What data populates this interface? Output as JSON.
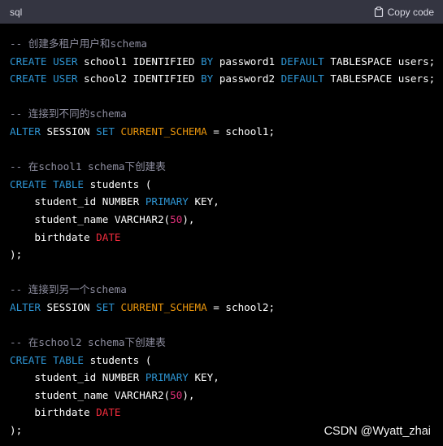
{
  "header": {
    "language": "sql",
    "copy_label": "Copy code"
  },
  "colors": {
    "header_bg": "#343541",
    "code_bg": "#000000",
    "comment": "#8e8ea0",
    "keyword": "#2e95d3",
    "type": "#f22c3d",
    "builtin": "#e9950c",
    "number": "#df3079",
    "text": "#ffffff"
  },
  "code": {
    "lines": [
      [
        {
          "t": "-- 创建多租户用户和schema",
          "c": "comment"
        }
      ],
      [
        {
          "t": "CREATE",
          "c": "kw"
        },
        {
          "t": " ",
          "c": "text"
        },
        {
          "t": "USER",
          "c": "kw"
        },
        {
          "t": " school1 IDENTIFIED ",
          "c": "text"
        },
        {
          "t": "BY",
          "c": "kw"
        },
        {
          "t": " password1 ",
          "c": "text"
        },
        {
          "t": "DEFAULT",
          "c": "kw"
        },
        {
          "t": " TABLESPACE users;",
          "c": "text"
        }
      ],
      [
        {
          "t": "CREATE",
          "c": "kw"
        },
        {
          "t": " ",
          "c": "text"
        },
        {
          "t": "USER",
          "c": "kw"
        },
        {
          "t": " school2 IDENTIFIED ",
          "c": "text"
        },
        {
          "t": "BY",
          "c": "kw"
        },
        {
          "t": " password2 ",
          "c": "text"
        },
        {
          "t": "DEFAULT",
          "c": "kw"
        },
        {
          "t": " TABLESPACE users;",
          "c": "text"
        }
      ],
      [],
      [
        {
          "t": "-- 连接到不同的schema",
          "c": "comment"
        }
      ],
      [
        {
          "t": "ALTER",
          "c": "kw"
        },
        {
          "t": " SESSION ",
          "c": "text"
        },
        {
          "t": "SET",
          "c": "kw"
        },
        {
          "t": " ",
          "c": "text"
        },
        {
          "t": "CURRENT_SCHEMA",
          "c": "builtin"
        },
        {
          "t": " = school1;",
          "c": "text"
        }
      ],
      [],
      [
        {
          "t": "-- 在school1 schema下创建表",
          "c": "comment"
        }
      ],
      [
        {
          "t": "CREATE",
          "c": "kw"
        },
        {
          "t": " ",
          "c": "text"
        },
        {
          "t": "TABLE",
          "c": "kw"
        },
        {
          "t": " students (",
          "c": "text"
        }
      ],
      [
        {
          "t": "    student_id NUMBER ",
          "c": "text"
        },
        {
          "t": "PRIMARY",
          "c": "kw"
        },
        {
          "t": " KEY,",
          "c": "text"
        }
      ],
      [
        {
          "t": "    student_name VARCHAR2(",
          "c": "text"
        },
        {
          "t": "50",
          "c": "num"
        },
        {
          "t": "),",
          "c": "text"
        }
      ],
      [
        {
          "t": "    birthdate ",
          "c": "text"
        },
        {
          "t": "DATE",
          "c": "name"
        }
      ],
      [
        {
          "t": ");",
          "c": "text"
        }
      ],
      [],
      [
        {
          "t": "-- 连接到另一个schema",
          "c": "comment"
        }
      ],
      [
        {
          "t": "ALTER",
          "c": "kw"
        },
        {
          "t": " SESSION ",
          "c": "text"
        },
        {
          "t": "SET",
          "c": "kw"
        },
        {
          "t": " ",
          "c": "text"
        },
        {
          "t": "CURRENT_SCHEMA",
          "c": "builtin"
        },
        {
          "t": " = school2;",
          "c": "text"
        }
      ],
      [],
      [
        {
          "t": "-- 在school2 schema下创建表",
          "c": "comment"
        }
      ],
      [
        {
          "t": "CREATE",
          "c": "kw"
        },
        {
          "t": " ",
          "c": "text"
        },
        {
          "t": "TABLE",
          "c": "kw"
        },
        {
          "t": " students (",
          "c": "text"
        }
      ],
      [
        {
          "t": "    student_id NUMBER ",
          "c": "text"
        },
        {
          "t": "PRIMARY",
          "c": "kw"
        },
        {
          "t": " KEY,",
          "c": "text"
        }
      ],
      [
        {
          "t": "    student_name VARCHAR2(",
          "c": "text"
        },
        {
          "t": "50",
          "c": "num"
        },
        {
          "t": "),",
          "c": "text"
        }
      ],
      [
        {
          "t": "    birthdate ",
          "c": "text"
        },
        {
          "t": "DATE",
          "c": "name"
        }
      ],
      [
        {
          "t": ");",
          "c": "text"
        }
      ]
    ]
  },
  "watermark": "CSDN @Wyatt_zhai"
}
